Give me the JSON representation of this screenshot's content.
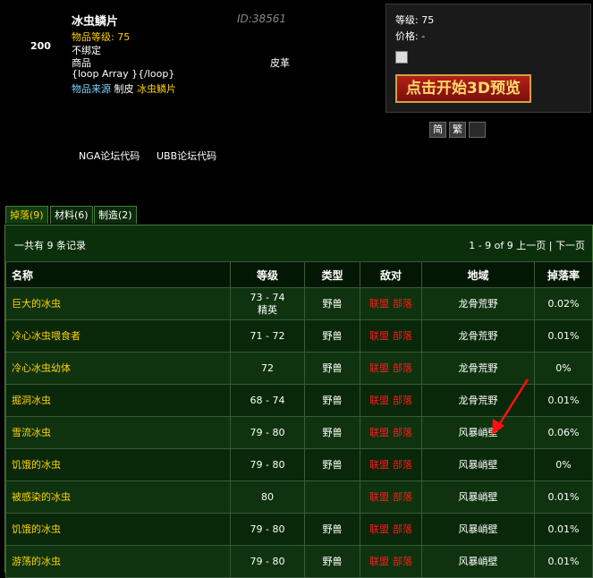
{
  "item": {
    "count": "200",
    "name": "冰虫鳞片",
    "id": "ID:38561",
    "level_line": "物品等级: 75",
    "binding": "不绑定",
    "goods": "商品",
    "loop": "{loop Array }{/loop}",
    "type": "皮革",
    "source_label": "物品来源",
    "source_method": "制皮",
    "source_item": "冰虫鳞片"
  },
  "preview": {
    "level": "等级: 75",
    "price": "价格: -",
    "button_label": "点击开始3D预览",
    "lang_simplified": "简",
    "lang_traditional": "繁",
    "lang_blank": ""
  },
  "codes": {
    "nga": "NGA论坛代码",
    "ubb": "UBB论坛代码"
  },
  "tabs": [
    {
      "label": "掉落(9)",
      "active": true
    },
    {
      "label": "材料(6)",
      "active": false
    },
    {
      "label": "制造(2)",
      "active": false
    }
  ],
  "records": {
    "summary": "一共有 9 条记录",
    "range": "1 - 9 of 9",
    "prev": "上一页",
    "sep": "|",
    "next": "下一页"
  },
  "columns": [
    "名称",
    "等级",
    "类型",
    "敌对",
    "地域",
    "掉落率"
  ],
  "rows": [
    {
      "name": "巨大的冰虫",
      "level": "73 - 74",
      "level2": "精英",
      "type": "野兽",
      "faction1": "联盟",
      "faction2": "部落",
      "zone": "龙骨荒野",
      "rate": "0.02%"
    },
    {
      "name": "冷心冰虫喂食者",
      "level": "71 - 72",
      "level2": "",
      "type": "野兽",
      "faction1": "联盟",
      "faction2": "部落",
      "zone": "龙骨荒野",
      "rate": "0.01%"
    },
    {
      "name": "冷心冰虫幼体",
      "level": "72",
      "level2": "",
      "type": "野兽",
      "faction1": "联盟",
      "faction2": "部落",
      "zone": "龙骨荒野",
      "rate": "0%"
    },
    {
      "name": "掘洞冰虫",
      "level": "68 - 74",
      "level2": "",
      "type": "野兽",
      "faction1": "联盟",
      "faction2": "部落",
      "zone": "龙骨荒野",
      "rate": "0.01%"
    },
    {
      "name": "雪流冰虫",
      "level": "79 - 80",
      "level2": "",
      "type": "野兽",
      "faction1": "联盟",
      "faction2": "部落",
      "zone": "风暴峭壁",
      "rate": "0.06%"
    },
    {
      "name": "饥饿的冰虫",
      "level": "79 - 80",
      "level2": "",
      "type": "野兽",
      "faction1": "联盟",
      "faction2": "部落",
      "zone": "风暴峭壁",
      "rate": "0%"
    },
    {
      "name": "被感染的冰虫",
      "level": "80",
      "level2": "",
      "type": "",
      "faction1": "联盟",
      "faction2": "部落",
      "zone": "风暴峭壁",
      "rate": "0.01%"
    },
    {
      "name": "饥饿的冰虫",
      "level": "79 - 80",
      "level2": "",
      "type": "野兽",
      "faction1": "联盟",
      "faction2": "部落",
      "zone": "风暴峭壁",
      "rate": "0.01%"
    },
    {
      "name": "游荡的冰虫",
      "level": "79 - 80",
      "level2": "",
      "type": "野兽",
      "faction1": "联盟",
      "faction2": "部落",
      "zone": "风暴峭壁",
      "rate": "0.01%"
    }
  ],
  "colors": {
    "yellow": "#ffd100",
    "blue": "#7bd5ff",
    "red": "#ff1a1a",
    "panel": "#0b2f0b"
  },
  "icons": {
    "arrow": "red-arrow-annotation"
  }
}
